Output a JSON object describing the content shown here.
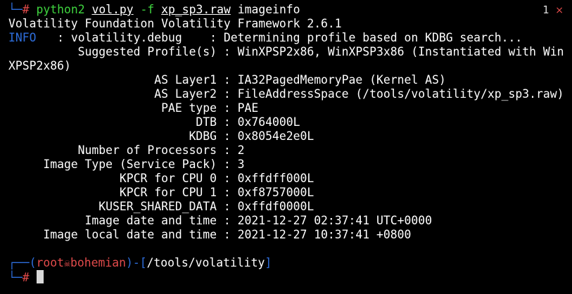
{
  "prompt_top": {
    "corner": "└─",
    "hash": "#",
    "cmd": "python2",
    "script": "vol.py",
    "flag": "-f",
    "file": "xp_sp3.raw",
    "plugin": "imageinfo"
  },
  "tab": {
    "number": "1",
    "close_glyph": "×"
  },
  "output": {
    "banner": "Volatility Foundation Volatility Framework 2.6.1",
    "info_tag": "INFO",
    "info_line": "   : volatility.debug    : Determining profile based on KDBG search...",
    "suggested_line": "          Suggested Profile(s) : WinXPSP2x86, WinXPSP3x86 (Instantiated with Win",
    "suggested_wrap": "XPSP2x86)",
    "lines": [
      "                     AS Layer1 : IA32PagedMemoryPae (Kernel AS)",
      "                     AS Layer2 : FileAddressSpace (/tools/volatility/xp_sp3.raw)",
      "                      PAE type : PAE",
      "                           DTB : 0x764000L",
      "                          KDBG : 0x8054e2e0L",
      "          Number of Processors : 2",
      "     Image Type (Service Pack) : 3",
      "                KPCR for CPU 0 : 0xffdff000L",
      "                KPCR for CPU 1 : 0xf8757000L",
      "             KUSER_SHARED_DATA : 0xffdf0000L",
      "           Image date and time : 2021-12-27 02:37:41 UTC+0000",
      "     Image local date and time : 2021-12-27 10:37:41 +0800"
    ]
  },
  "prompt_bottom": {
    "corner_top": "┌──(",
    "user": "root",
    "skull": "☠",
    "host": "bohemian",
    "sep": ")-[",
    "path": "/tools/volatility",
    "close_bracket": "]",
    "corner_bottom": "└─",
    "hash": "#"
  },
  "colors": {
    "background": "#000000",
    "prompt_blue": "#2e6edc",
    "root_red": "#e34b4b",
    "command_green": "#3fd43f"
  }
}
